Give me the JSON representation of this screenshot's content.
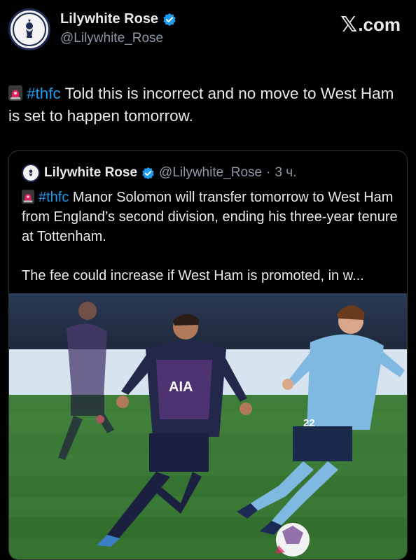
{
  "post": {
    "display_name": "Lilywhite Rose",
    "handle": "@Lilywhite_Rose",
    "hashtag": "#thfc",
    "text": " Told this is incorrect and no move to West Ham is set to happen tomorrow."
  },
  "brand": {
    "x_glyph": "𝕏",
    "label": ".com"
  },
  "avatar": {
    "ring_text": "LILYWHITE ROSE"
  },
  "quote": {
    "display_name": "Lilywhite Rose",
    "handle": "@Lilywhite_Rose",
    "separator": "·",
    "time": "3 ч.",
    "hashtag": "#thfc",
    "text_line1": " Manor Solomon will transfer tomorrow to West Ham from England’s second division, ending his three-year tenure at Tottenham.",
    "text_line2": "The fee could increase if West Ham is promoted, in w...",
    "photo": {
      "left_sponsor": "AIA",
      "right_number": "22",
      "icons": [
        "football-match-photo"
      ]
    }
  },
  "colors": {
    "background": "#000000",
    "text": "#e7e9ea",
    "muted": "#8b98a5",
    "link": "#1d9bf0",
    "verified": "#1d9bf0",
    "border": "#2f3336"
  }
}
